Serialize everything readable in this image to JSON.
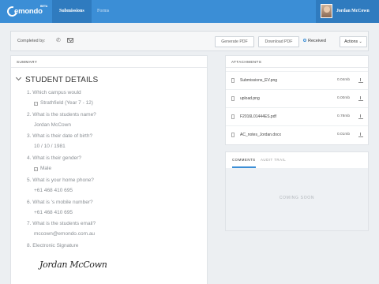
{
  "app": {
    "logo_text": "emondo",
    "logo_badge": "BETA",
    "nav": [
      {
        "label": "Submissions"
      },
      {
        "label": "Forms"
      }
    ],
    "user_name": "Jordan McCown"
  },
  "toolbar": {
    "completed_by_label": "Completed by:",
    "generate_pdf": "Generate PDF",
    "download_pdf": "Download PDF",
    "status": "Received",
    "actions": "Actions ⌄"
  },
  "summary": {
    "header": "SUMMARY",
    "section_title": "STUDENT DETAILS",
    "items": [
      {
        "q": "1. Which campus would",
        "a": "Strathfield (Year 7 - 12)"
      },
      {
        "q": "2. What is the students name?",
        "a": "Jordan McCown"
      },
      {
        "q": "3. What is their date of birth?",
        "a": "10 / 10 / 1981"
      },
      {
        "q": "4. What is their gender?",
        "a": "Male"
      },
      {
        "q": "5. What is your home phone?",
        "a": "+61 468 410 695"
      },
      {
        "q": "6. What is 's mobile number?",
        "a": "+61 468 410 695"
      },
      {
        "q": "7. What is the students email?",
        "a": "mccown@emondo.com.au"
      },
      {
        "q": "8. Electronic Signature",
        "a": "Jordan McCown"
      }
    ]
  },
  "attachments": {
    "header": "ATTACHMENTS",
    "files": [
      {
        "name": "Submissions_EV.png",
        "size": "0.04mb"
      },
      {
        "name": "upload.png",
        "size": "0.00mb"
      },
      {
        "name": "F2016L01444ES.pdf",
        "size": "0.78mb"
      },
      {
        "name": "AC_notes_Jordan.docx",
        "size": "0.01mb"
      }
    ]
  },
  "comments": {
    "tabs": [
      {
        "label": "COMMENTS"
      },
      {
        "label": "AUDIT TRAIL"
      }
    ],
    "placeholder": "COMING SOON"
  }
}
